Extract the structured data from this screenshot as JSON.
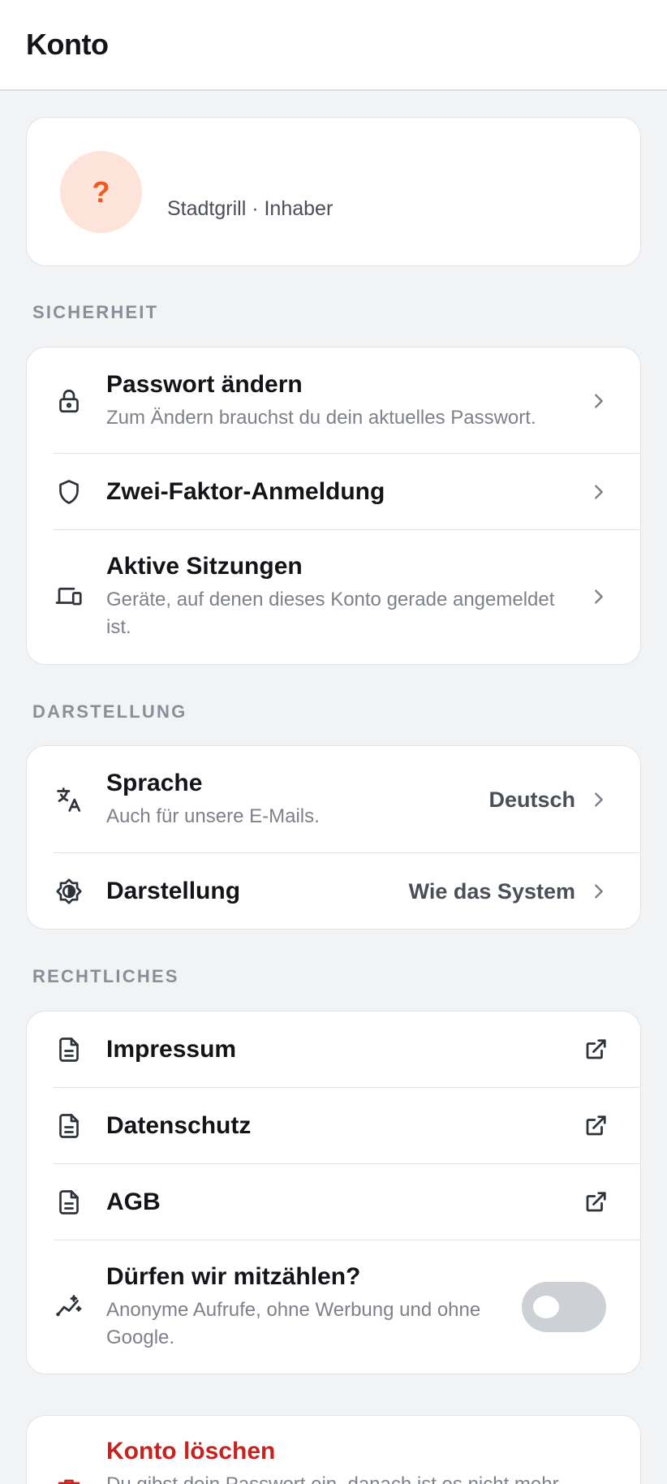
{
  "header": {
    "title": "Konto"
  },
  "profile": {
    "avatar_glyph": "?",
    "subtitle": "Stadtgrill · Inhaber"
  },
  "sections": {
    "security": {
      "label": "SICHERHEIT",
      "items": [
        {
          "title": "Passwort ändern",
          "subtitle": "Zum Ändern brauchst du dein aktuelles Passwort.",
          "icon": "lock-icon"
        },
        {
          "title": "Zwei-Faktor-Anmeldung",
          "icon": "shield-icon"
        },
        {
          "title": "Aktive Sitzungen",
          "subtitle": "Geräte, auf denen dieses Konto gerade angemeldet ist.",
          "icon": "devices-icon"
        }
      ]
    },
    "appearance": {
      "label": "DARSTELLUNG",
      "items": [
        {
          "title": "Sprache",
          "subtitle": "Auch für unsere E-Mails.",
          "value": "Deutsch",
          "icon": "translate-icon"
        },
        {
          "title": "Darstellung",
          "value": "Wie das System",
          "icon": "brightness-icon"
        }
      ]
    },
    "legal": {
      "label": "RECHTLICHES",
      "items": [
        {
          "title": "Impressum",
          "icon": "document-icon"
        },
        {
          "title": "Datenschutz",
          "icon": "document-icon"
        },
        {
          "title": "AGB",
          "icon": "document-icon"
        },
        {
          "title": "Dürfen wir mitzählen?",
          "subtitle": "Anonyme Aufrufe, ohne Werbung und ohne Google.",
          "icon": "analytics-icon",
          "toggle_on": false
        }
      ]
    },
    "danger": {
      "items": [
        {
          "title": "Konto löschen",
          "subtitle": "Du gibst dein Passwort ein, danach ist es nicht mehr rückgängig zu machen.",
          "icon": "trash-icon"
        }
      ]
    }
  },
  "colors": {
    "accent_orange": "#f05a22",
    "avatar_bg": "#fde4da",
    "danger": "#c4231f",
    "toggle_off": "#cdd0d4"
  }
}
